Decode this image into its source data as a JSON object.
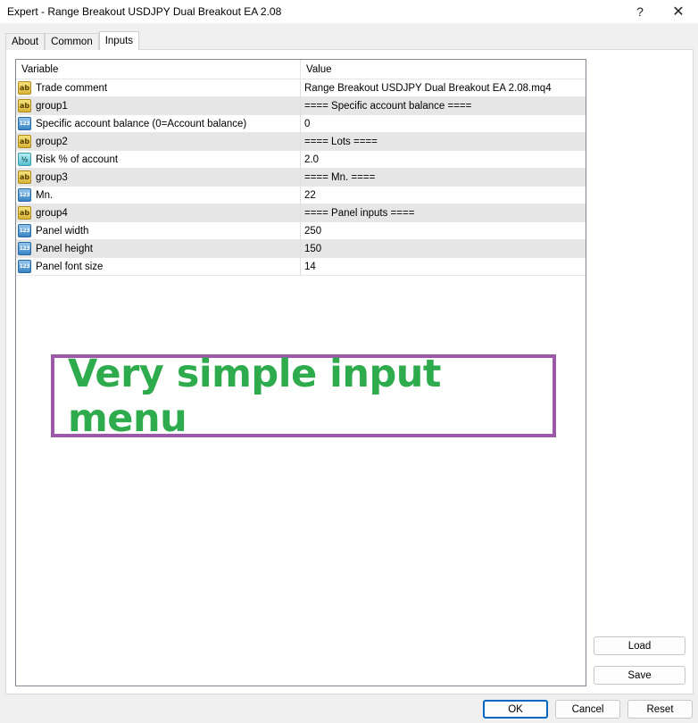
{
  "window": {
    "title": "Expert - Range Breakout USDJPY Dual Breakout EA 2.08",
    "help_symbol": "?",
    "close_symbol": "✕"
  },
  "tabs": [
    {
      "label": "About"
    },
    {
      "label": "Common"
    },
    {
      "label": "Inputs",
      "active": true
    }
  ],
  "grid": {
    "headers": {
      "variable": "Variable",
      "value": "Value"
    },
    "rows": [
      {
        "icon": "ab",
        "icon_text": "ab",
        "variable": "Trade comment",
        "value": "Range Breakout USDJPY Dual Breakout EA 2.08.mq4"
      },
      {
        "icon": "ab",
        "icon_text": "ab",
        "variable": "group1",
        "value": "==== Specific account balance ===="
      },
      {
        "icon": "num",
        "icon_text": "123",
        "variable": "Specific account balance (0=Account balance)",
        "value": "0"
      },
      {
        "icon": "ab",
        "icon_text": "ab",
        "variable": "group2",
        "value": "==== Lots  ===="
      },
      {
        "icon": "frac",
        "icon_text": "½",
        "variable": "Risk % of account",
        "value": "2.0"
      },
      {
        "icon": "ab",
        "icon_text": "ab",
        "variable": "group3",
        "value": "==== Mn. ===="
      },
      {
        "icon": "num",
        "icon_text": "123",
        "variable": "Mn.",
        "value": "22"
      },
      {
        "icon": "ab",
        "icon_text": "ab",
        "variable": "group4",
        "value": "==== Panel inputs ===="
      },
      {
        "icon": "num",
        "icon_text": "123",
        "variable": "Panel width",
        "value": "250"
      },
      {
        "icon": "num",
        "icon_text": "123",
        "variable": "Panel height",
        "value": "150"
      },
      {
        "icon": "num",
        "icon_text": "123",
        "variable": "Panel font size",
        "value": "14"
      }
    ]
  },
  "callout": {
    "text": "Very simple input menu",
    "border_color": "#9b59a8",
    "text_color": "#2eab4c"
  },
  "side_buttons": {
    "load": "Load",
    "save": "Save"
  },
  "bottom_buttons": {
    "ok": "OK",
    "cancel": "Cancel",
    "reset": "Reset"
  }
}
